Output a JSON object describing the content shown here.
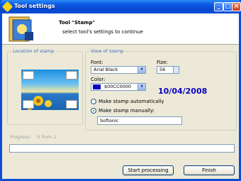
{
  "window": {
    "title": "Tool settings"
  },
  "header": {
    "title": "Tool \"Stamp\"",
    "subtitle": "select tool's settings to continue"
  },
  "location_group": {
    "title": "Location of stamp"
  },
  "view_group": {
    "title": "View of stamp",
    "font_label": "Font:",
    "font_value": "Arial Black",
    "size_label": "Fize:",
    "size_value": "56",
    "color_label": "Color:",
    "color_value": "$00CC0000",
    "color_hex": "#0c00c0",
    "preview_date": "10/04/2008",
    "radio_auto_label": "Make stamp automatically",
    "radio_manual_label": "Make stamp manually:",
    "manual_text": "Softonic"
  },
  "progress": {
    "label": "Progress:",
    "value_text": "0 from 1",
    "fraction": 0
  },
  "buttons": {
    "start": "Start processing",
    "finish": "Finish"
  }
}
